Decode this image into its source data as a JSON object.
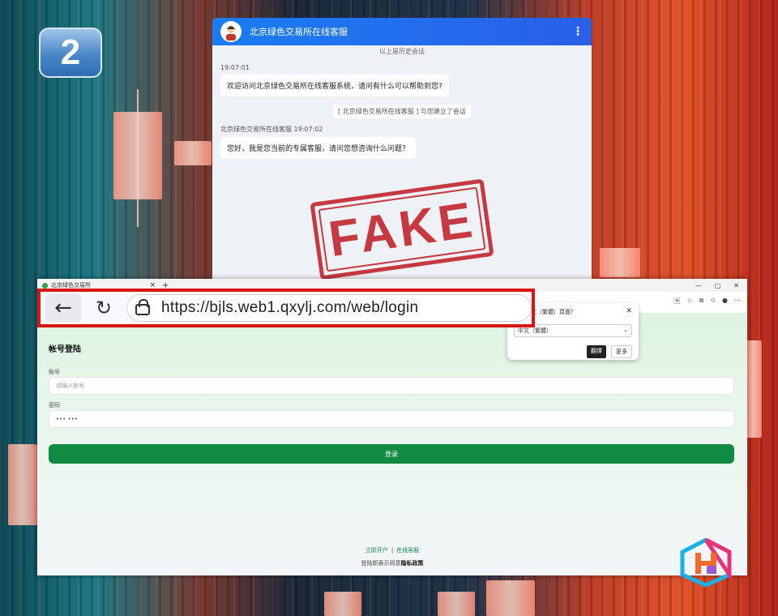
{
  "badge": {
    "number": "2"
  },
  "chat": {
    "title": "北京绿色交易所在线客服",
    "history_notice": "以上是历史会话",
    "messages": [
      {
        "time": "19:07:01",
        "text": "欢迎访问北京绿色交易所在线客服系统，请问有什么可以帮助到您?"
      },
      {
        "system": "[ 北京绿色交易所在线客服 ] 与您建立了会话"
      },
      {
        "sender_time": "北京绿色交易所在线客服 19:07:02",
        "text": "您好，我是您当前的专属客服，请问您想咨询什么问题？"
      }
    ]
  },
  "stamp": {
    "text": "FAKE"
  },
  "browser": {
    "tab_title": "北京绿色交易所",
    "url": "https://bjls.web1.qxylj.com/web/login",
    "translate_popup": {
      "title": "翻譯中文（繁體）頁面？",
      "select_value": "中文（繁體）",
      "translate_button": "翻譯",
      "more_button": "更多"
    },
    "login": {
      "title": "帐号登陆",
      "account_label": "账号",
      "account_placeholder": "请输入账号",
      "password_label": "密码",
      "password_value": "••• •••",
      "submit": "登录"
    },
    "footer": {
      "open_account": "立即开户",
      "online_service": "在线客服",
      "note": "登陆即表示同意",
      "privacy": "隐私政策"
    }
  },
  "colors": {
    "accent_green": "#118a43",
    "highlight_red": "#d81414",
    "chat_header": "#1a7df2"
  }
}
